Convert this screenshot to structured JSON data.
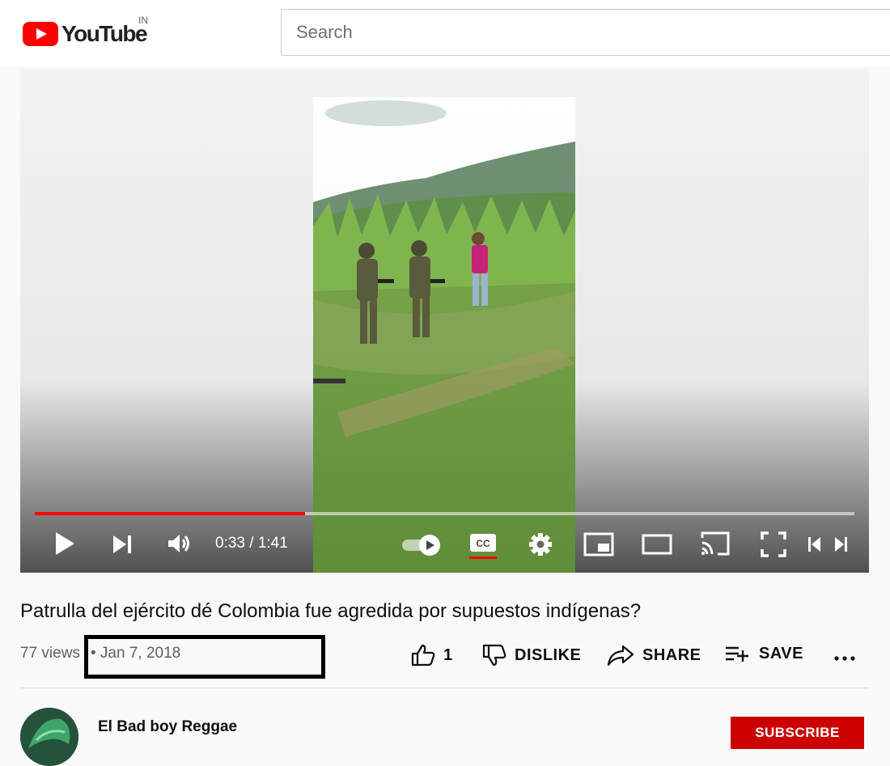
{
  "header": {
    "logo_text": "YouTube",
    "country_code": "IN",
    "search_placeholder": "Search"
  },
  "player": {
    "current_time": "0:33",
    "duration": "1:41",
    "time_display": "0:33 / 1:41",
    "progress_fraction": 0.33,
    "cc_label": "CC",
    "icons": [
      "play-icon",
      "next-icon",
      "volume-icon",
      "autoplay-toggle-icon",
      "cc-icon",
      "settings-icon",
      "miniplayer-icon",
      "theater-mode-icon",
      "cast-icon",
      "fullscreen-icon",
      "prev-chapter-icon",
      "next-chapter-icon"
    ]
  },
  "video": {
    "title": "Patrulla del ejército dé Colombia fue agredida por supuestos indígenas?",
    "views": "77 views",
    "date": "• Jan 7, 2018"
  },
  "actions": {
    "like_count": "1",
    "dislike_label": "DISLIKE",
    "share_label": "SHARE",
    "save_label": "SAVE",
    "more_label": "..."
  },
  "channel": {
    "name": "El Bad boy Reggae",
    "subscribe_label": "SUBSCRIBE"
  },
  "colors": {
    "accent_red": "#ff0000",
    "subscribe_red": "#cc0000",
    "text_secondary": "#606060"
  }
}
